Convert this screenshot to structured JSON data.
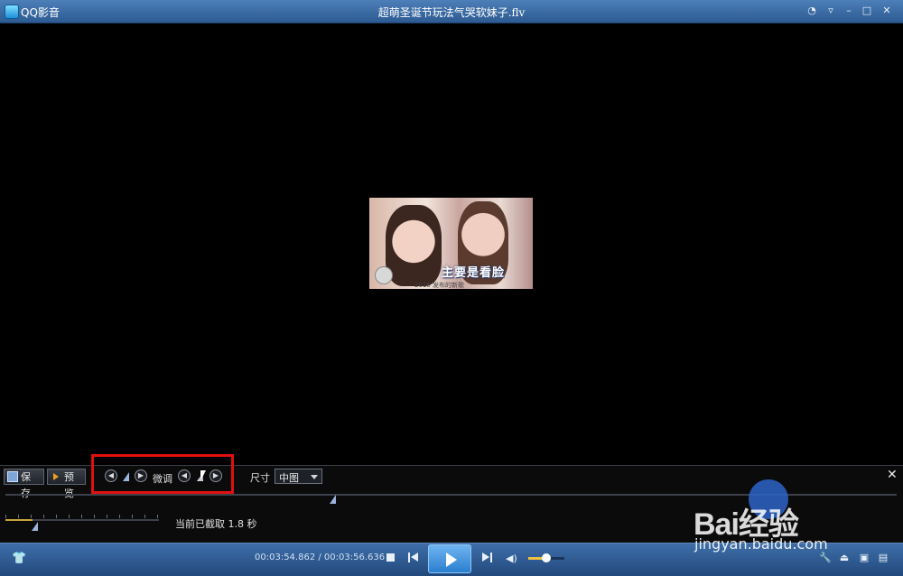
{
  "window": {
    "app_name": "QQ影音",
    "file_title": "超萌圣诞节玩法气哭软妹子.flv",
    "controls": [
      "chat-icon",
      "minimize-icon",
      "restore-icon",
      "close-icon"
    ]
  },
  "video": {
    "thumbnail_caption": "主要是看脸",
    "thumbnail_subcaption": "2015 发布的新歌"
  },
  "capture_panel": {
    "save_label": "保存",
    "preview_label": "预览",
    "fine_tune_label": "微调",
    "size_label": "尺寸",
    "size_value": "中图",
    "status_text": "当前已截取 1.8 秒"
  },
  "playback": {
    "time_text": "00:03:54.862 / 00:03:56.636",
    "volume_level": 0.5
  },
  "watermark": {
    "logo_text": "Bai经验",
    "url": "jingyan.baidu.com"
  }
}
